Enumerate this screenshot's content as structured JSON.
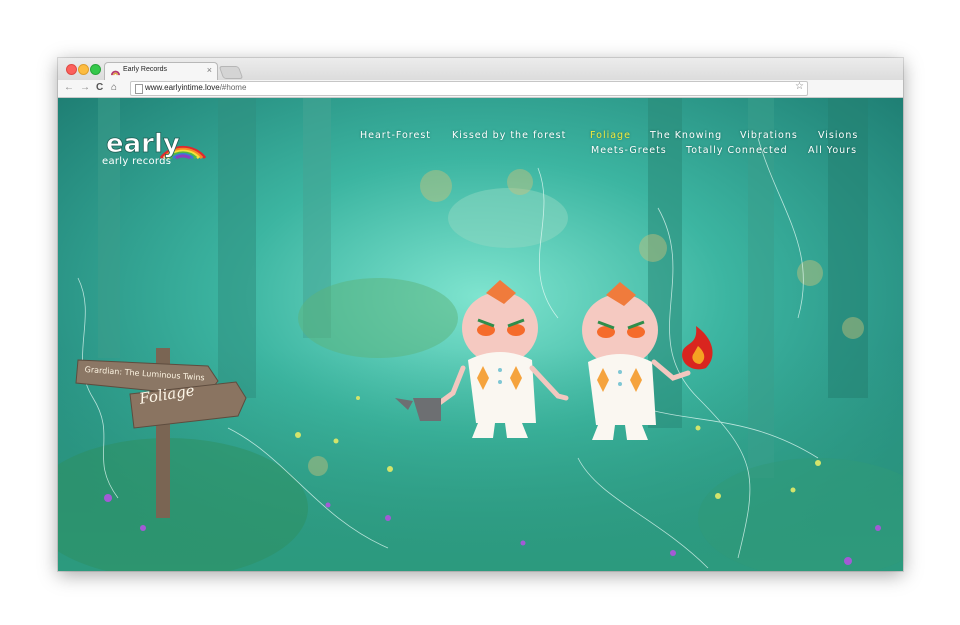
{
  "browser": {
    "tab_title": "Early Records",
    "tab_close": "×",
    "url_host": "www.earlyintime.love",
    "url_path": "/#home",
    "nav_back": "←",
    "nav_forward": "→",
    "nav_reload": "C",
    "nav_home": "⌂",
    "bookmark_star": "☆"
  },
  "site": {
    "logo_text": "early",
    "logo_subtitle": "early records",
    "nav": [
      {
        "label": "Heart-Forest",
        "active": false
      },
      {
        "label": "Kissed by the forest",
        "active": false
      },
      {
        "label": "Foliage",
        "active": true
      },
      {
        "label": "The Knowing",
        "active": false
      },
      {
        "label": "Vibrations",
        "active": false
      },
      {
        "label": "Visions",
        "active": false
      },
      {
        "label": "Meets-Greets",
        "active": false
      },
      {
        "label": "Totally Connected",
        "active": false
      },
      {
        "label": "All Yours",
        "active": false
      }
    ],
    "sign": {
      "small": "Grardian: The Luminous Twins",
      "big": "Foliage"
    }
  },
  "colors": {
    "forest": "#3aaa9a",
    "nav_text": "#ffffff",
    "nav_active": "#f2ea3d"
  }
}
